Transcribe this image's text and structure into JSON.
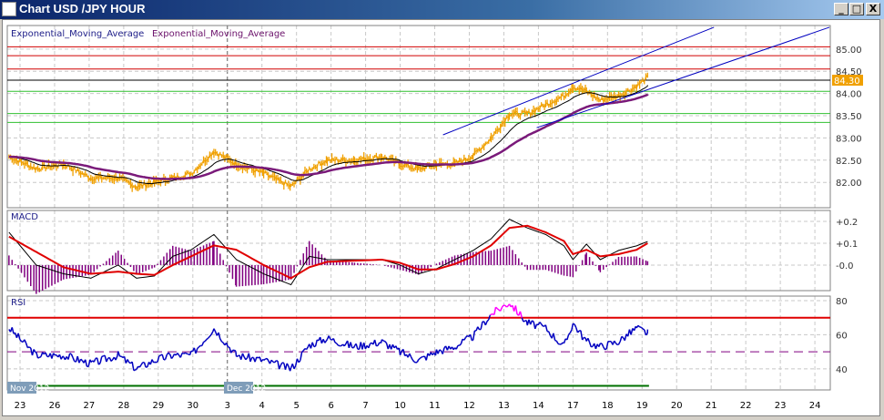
{
  "window": {
    "title": "Chart USD /JPY  HOUR",
    "minimize": "_",
    "maximize": "□",
    "close": "X"
  },
  "legend": {
    "ema1": "Exponential_Moving_Average",
    "ema2": "Exponential_Moving_Average"
  },
  "panels": {
    "macd_label": "MACD",
    "rsi_label": "RSI"
  },
  "month_labels": {
    "nov": "Nov 2012",
    "dec": "Dec 2012"
  },
  "colors": {
    "price": "#f0a000",
    "ema_fast": "#000000",
    "ema_slow": "#7a1a7a",
    "channel": "#0000c0",
    "resistance": "#d00000",
    "current": "#000000",
    "support": "#30c030",
    "macd": "#000000",
    "signal": "#e00000",
    "hist": "#800080",
    "rsi": "#0000c0",
    "rsi_over": "#ff00ff",
    "rsi_70": "#e00000",
    "rsi_50": "#800080",
    "rsi_30": "#007000"
  },
  "chart_data": [
    {
      "type": "line",
      "name": "price",
      "title": "Chart USD /JPY  HOUR",
      "x_tick_labels": [
        "23",
        "26",
        "27",
        "28",
        "29",
        "30",
        "3",
        "4",
        "5",
        "6",
        "7",
        "10",
        "11",
        "12",
        "13",
        "14",
        "17",
        "18",
        "19",
        "20",
        "21",
        "22",
        "23",
        "24"
      ],
      "y_tick_labels": [
        "85.00",
        "84.50",
        "84.00",
        "83.50",
        "83.00",
        "82.50",
        "82.00"
      ],
      "y_ticks": [
        85,
        84.5,
        84,
        83.5,
        83,
        82.5,
        82
      ],
      "ylim": [
        81.43,
        85.53
      ],
      "xlim": [
        -0.37,
        23.44
      ],
      "x": [
        -0.32,
        0.47,
        1.26,
        2.05,
        2.84,
        3.37,
        3.89,
        4.42,
        4.95,
        5.61,
        6.26,
        7.05,
        7.84,
        8.37,
        8.89,
        9.68,
        10.47,
        11.0,
        11.53,
        12.05,
        12.58,
        13.11,
        13.63,
        14.16,
        14.68,
        15.21,
        15.74,
        16.0,
        16.39,
        16.79,
        17.32,
        17.84,
        18.16
      ],
      "close": [
        82.58,
        82.31,
        82.41,
        82.1,
        82.1,
        81.9,
        82.0,
        82.1,
        82.2,
        82.7,
        82.41,
        82.2,
        81.9,
        82.3,
        82.5,
        82.5,
        82.58,
        82.41,
        82.3,
        82.41,
        82.41,
        82.6,
        83.0,
        83.54,
        83.54,
        83.75,
        83.95,
        84.16,
        84.05,
        83.85,
        83.95,
        84.16,
        84.36
      ],
      "current_price": "84.30",
      "hlines": [
        {
          "kind": "resistance",
          "value": 85.05
        },
        {
          "kind": "resistance",
          "value": 84.85
        },
        {
          "kind": "resistance",
          "value": 84.55
        },
        {
          "kind": "current",
          "value": 84.3
        },
        {
          "kind": "support",
          "value": 84.05
        },
        {
          "kind": "support",
          "value": 83.55
        },
        {
          "kind": "support",
          "value": 83.35
        }
      ],
      "channel": [
        {
          "from": [
            12.24,
            83.07
          ],
          "to": [
            20.08,
            85.49
          ]
        },
        {
          "from": [
            14.95,
            83.23
          ],
          "to": [
            23.42,
            85.49
          ]
        }
      ]
    },
    {
      "type": "line",
      "name": "macd",
      "y_tick_labels": [
        "+0.2",
        "+0.1",
        "-0.0"
      ],
      "y_ticks": [
        0.2,
        0.1,
        0
      ],
      "ylim": [
        -0.117,
        0.25
      ],
      "macd": [
        0.15,
        0.0,
        -0.04,
        -0.06,
        0.0,
        -0.06,
        -0.05,
        0.04,
        0.07,
        0.14,
        0.025,
        -0.04,
        -0.09,
        0.04,
        0.025,
        0.025,
        0.025,
        0.0,
        -0.04,
        -0.017,
        0.025,
        0.067,
        0.12,
        0.21,
        0.17,
        0.14,
        0.088,
        0.025,
        0.096,
        0.025,
        0.067,
        0.088,
        0.108
      ],
      "signal": [
        0.13,
        0.06,
        -0.01,
        -0.04,
        -0.03,
        -0.04,
        -0.045,
        0.0,
        0.04,
        0.09,
        0.07,
        0.0,
        -0.06,
        -0.01,
        0.015,
        0.02,
        0.025,
        0.01,
        -0.02,
        -0.02,
        0.005,
        0.04,
        0.09,
        0.17,
        0.18,
        0.15,
        0.11,
        0.05,
        0.07,
        0.04,
        0.05,
        0.07,
        0.1
      ]
    },
    {
      "type": "line",
      "name": "rsi",
      "y_tick_labels": [
        "80",
        "60",
        "40"
      ],
      "y_ticks": [
        80,
        60,
        40
      ],
      "ylim": [
        27.6,
        82.7
      ],
      "levels": [
        70,
        50,
        30
      ],
      "values": [
        64,
        48,
        48,
        43,
        48,
        40,
        45,
        48,
        48,
        64,
        48,
        45,
        40,
        54,
        58,
        53,
        56,
        50,
        45,
        50,
        53,
        59,
        72,
        79,
        67,
        64,
        53,
        67,
        56,
        53,
        56,
        64,
        61
      ]
    }
  ]
}
